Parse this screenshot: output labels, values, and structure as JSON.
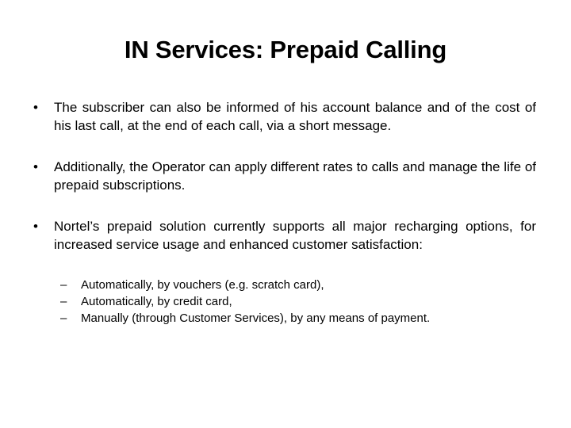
{
  "slide": {
    "title": "IN Services: Prepaid Calling",
    "background_color": "#ffffff",
    "text_color": "#000000",
    "bullet_marker": "•",
    "sub_bullet_marker": "–",
    "bullets": [
      {
        "text": "The subscriber can also be informed of his account balance and of the cost of his last call, at the end of each call, via a short message."
      },
      {
        "text": "Additionally, the Operator can apply different rates to calls and manage the life of prepaid subscriptions."
      },
      {
        "text": "Nortel’s prepaid solution currently supports all major recharging options, for increased service usage and enhanced customer satisfaction:",
        "sub_items": [
          "Automatically, by vouchers (e.g. scratch card),",
          "Automatically, by credit card,",
          "Manually (through Customer Services), by any means of payment."
        ]
      }
    ]
  }
}
